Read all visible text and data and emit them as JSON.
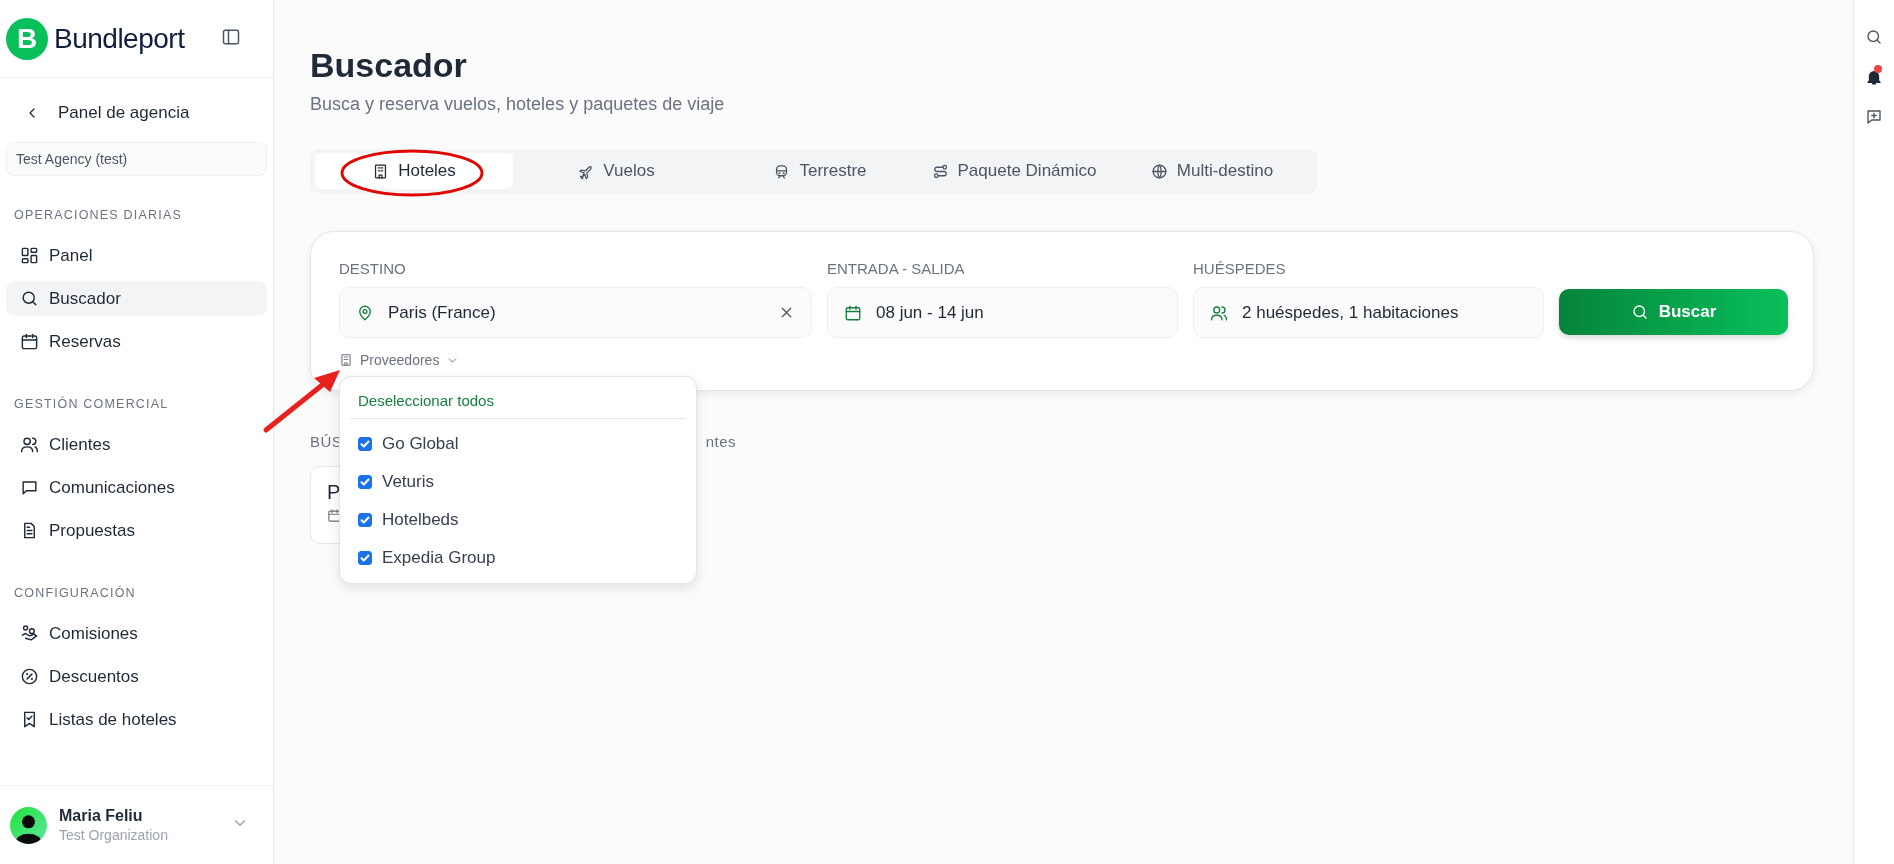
{
  "brand": {
    "mark": "B",
    "name": "Bundleport"
  },
  "sidebar": {
    "back_link": "Panel de agencia",
    "agency": "Test Agency (test)",
    "sections": [
      {
        "heading": "OPERACIONES DIARIAS",
        "items": [
          {
            "label": "Panel",
            "selected": false
          },
          {
            "label": "Buscador",
            "selected": true
          },
          {
            "label": "Reservas",
            "selected": false
          }
        ]
      },
      {
        "heading": "GESTIÓN COMERCIAL",
        "items": [
          {
            "label": "Clientes",
            "selected": false
          },
          {
            "label": "Comunicaciones",
            "selected": false
          },
          {
            "label": "Propuestas",
            "selected": false
          }
        ]
      },
      {
        "heading": "CONFIGURACIÓN",
        "items": [
          {
            "label": "Comisiones",
            "selected": false
          },
          {
            "label": "Descuentos",
            "selected": false
          },
          {
            "label": "Listas de hoteles",
            "selected": false
          }
        ]
      }
    ]
  },
  "user": {
    "name": "Maria Feliu",
    "organization": "Test Organization"
  },
  "page": {
    "title": "Buscador",
    "subtitle": "Busca y reserva vuelos, hoteles y paquetes de viaje"
  },
  "tabs": [
    {
      "label": "Hoteles",
      "selected": true
    },
    {
      "label": "Vuelos",
      "selected": false
    },
    {
      "label": "Terrestre",
      "selected": false
    },
    {
      "label": "Paquete Dinámico",
      "selected": false
    },
    {
      "label": "Multi-destino",
      "selected": false
    }
  ],
  "search": {
    "fields": [
      {
        "kind": "destination",
        "label": "DESTINO",
        "value": "Paris (France)"
      },
      {
        "kind": "dates",
        "label": "ENTRADA - SALIDA",
        "value": "08 jun - 14 jun"
      },
      {
        "kind": "guests",
        "label": "HUÉSPEDES",
        "value": "2 huéspedes, 1 habitaciones"
      }
    ],
    "button": "Buscar",
    "providers_toggle": "Proveedores"
  },
  "providers_menu": {
    "action": "Deseleccionar todos",
    "items": [
      {
        "label": "Go Global",
        "checked": true
      },
      {
        "label": "Veturis",
        "checked": true
      },
      {
        "label": "Hotelbeds",
        "checked": true
      },
      {
        "label": "Expedia Group",
        "checked": true
      }
    ]
  },
  "recent": {
    "heading_start": "BÚS",
    "heading_end": "ntes",
    "card_title": "P"
  },
  "notifications": {
    "unread": true
  }
}
